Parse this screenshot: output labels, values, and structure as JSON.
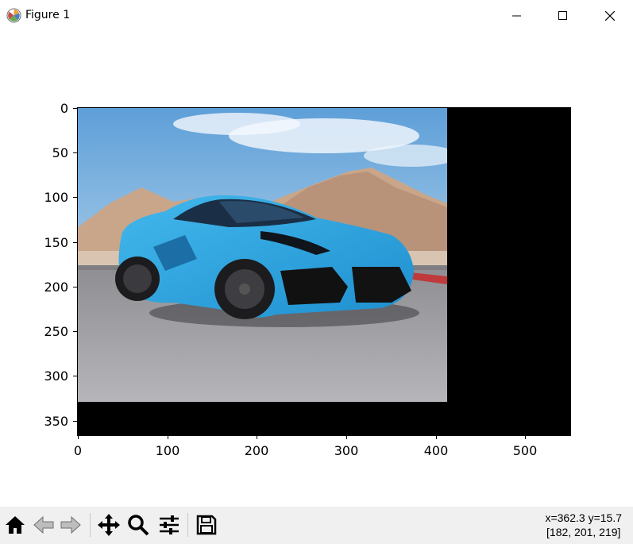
{
  "window": {
    "title": "Figure 1"
  },
  "plot": {
    "y_ticks": [
      "0",
      "50",
      "100",
      "150",
      "200",
      "250",
      "300",
      "350"
    ],
    "x_ticks": [
      "0",
      "100",
      "200",
      "300",
      "400",
      "500"
    ]
  },
  "toolbar": {
    "buttons": [
      "home-icon",
      "back-icon",
      "forward-icon",
      "pan-icon",
      "zoom-icon",
      "configure-subplots-icon",
      "save-icon"
    ]
  },
  "status": {
    "coords": "x=362.3 y=15.7",
    "pixel_value": "[182, 201, 219]"
  },
  "colors": {
    "car": "#2aa6e0",
    "sky": "#8cc0e6",
    "image_padding": "#000000"
  }
}
